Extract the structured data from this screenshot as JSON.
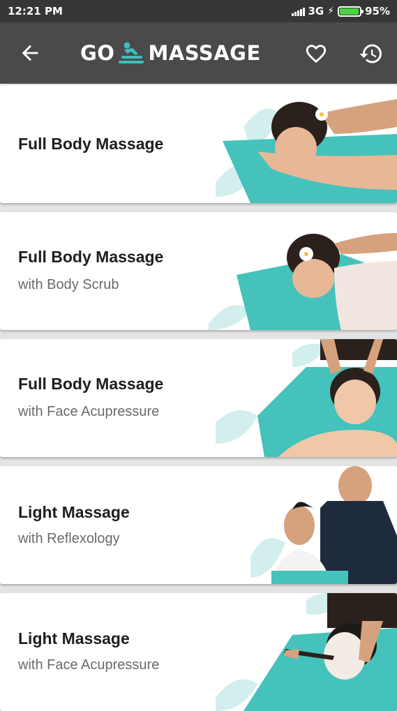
{
  "status": {
    "time": "12:21 PM",
    "network": "3G",
    "battery": "95%",
    "battery_level": 0.95
  },
  "header": {
    "logo_left": "GO",
    "logo_right": "MASSAGE",
    "back_icon": "arrow-left-icon",
    "favorite_icon": "heart-icon",
    "history_icon": "history-icon"
  },
  "services": [
    {
      "title": "Full Body Massage",
      "subtitle": ""
    },
    {
      "title": "Full Body Massage",
      "subtitle": "with Body Scrub"
    },
    {
      "title": "Full Body Massage",
      "subtitle": "with Face Acupressure"
    },
    {
      "title": "Light Massage",
      "subtitle": "with Reflexology"
    },
    {
      "title": "Light Massage",
      "subtitle": "with Face Acupressure"
    }
  ],
  "colors": {
    "appbar": "#4a4a4a",
    "statusbar": "#363636",
    "accent_teal": "#3cbfbd",
    "brand_green": "#00aed6"
  }
}
